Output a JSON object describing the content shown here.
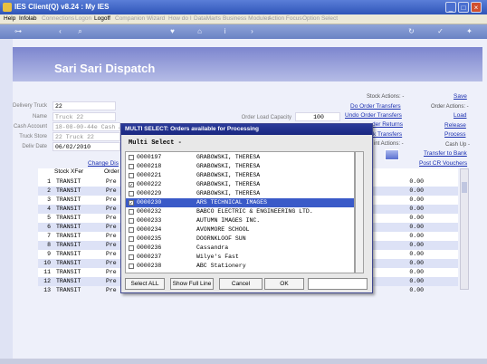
{
  "window": {
    "title": "IES Client(Q) v8.24 : My IES",
    "min": "_",
    "max": "□",
    "close": "×"
  },
  "menu": [
    {
      "label": "Help",
      "disabled": false
    },
    {
      "label": "Infolab",
      "disabled": false
    },
    {
      "label": "Connections",
      "disabled": true
    },
    {
      "label": "Logon",
      "disabled": true
    },
    {
      "label": "Logoff",
      "disabled": false
    },
    {
      "label": "Companion",
      "disabled": true
    },
    {
      "label": "Wizard",
      "disabled": true
    },
    {
      "label": "How do I",
      "disabled": true
    },
    {
      "label": "DataMarts",
      "disabled": true
    },
    {
      "label": "Business Modules",
      "disabled": true
    },
    {
      "label": "Action Focus",
      "disabled": true
    },
    {
      "label": "Option Select",
      "disabled": true
    }
  ],
  "toolbar_icons": [
    "key-icon",
    "back-icon",
    "search-icon",
    "heart-icon",
    "home-icon",
    "info-icon",
    "forward-icon",
    "check-icon"
  ],
  "page_title": "Sari Sari Dispatch",
  "form": {
    "delivery_truck_label": "Delivery Truck",
    "delivery_truck": "22",
    "name_label": "Name",
    "name": "Truck 22",
    "cash_account_label": "Cash Account",
    "cash_account": "18-08-00-44e Cash A",
    "truck_store_label": "Truck Store",
    "truck_store": "22 Truck 22",
    "delivery_date_label": "Deliv Date",
    "delivery_date": "06/02/2010",
    "order_load_capacity_label": "Order Load Capacity",
    "order_load_capacity": "100",
    "change_link": "Change Dis"
  },
  "actions": {
    "stock_actions": "Stock Actions: -",
    "do_order_transfers": "Do Order Transfers",
    "undo_order_transfers": "Undo Order Transfers",
    "order_returns": "der Returns",
    "transfers": "k Transfers",
    "print_actions": "int Actions: -",
    "save": "Save",
    "order_actions": "Order Actions: -",
    "load": "Load",
    "release": "Release",
    "process": "Process",
    "cash_up": "Cash Up -",
    "transfer_to_bank": "Transfer to Bank",
    "post_cr_vouchers": "Post CR Vouchers"
  },
  "grid": {
    "col_stock_xfer": "Stock XFer",
    "col_order": "Order",
    "rows": [
      {
        "n": "1",
        "xfer": "TRANSIT",
        "order": "Pre",
        "amount": "0.00"
      },
      {
        "n": "2",
        "xfer": "TRANSIT",
        "order": "Pre",
        "amount": "0.00"
      },
      {
        "n": "3",
        "xfer": "TRANSIT",
        "order": "Pre",
        "amount": "0.00"
      },
      {
        "n": "4",
        "xfer": "TRANSIT",
        "order": "Pre",
        "amount": "0.00"
      },
      {
        "n": "5",
        "xfer": "TRANSIT",
        "order": "Pre",
        "amount": "0.00"
      },
      {
        "n": "6",
        "xfer": "TRANSIT",
        "order": "Pre",
        "amount": "0.00"
      },
      {
        "n": "7",
        "xfer": "TRANSIT",
        "order": "Pre",
        "amount": "0.00"
      },
      {
        "n": "8",
        "xfer": "TRANSIT",
        "order": "Pre",
        "amount": "0.00"
      },
      {
        "n": "9",
        "xfer": "TRANSIT",
        "order": "Pre",
        "amount": "0.00"
      },
      {
        "n": "10",
        "xfer": "TRANSIT",
        "order": "Pre",
        "amount": "0.00"
      },
      {
        "n": "11",
        "xfer": "TRANSIT",
        "order": "Pre",
        "amount": "0.00"
      },
      {
        "n": "12",
        "xfer": "TRANSIT",
        "order": "Pre",
        "amount": "0.00"
      },
      {
        "n": "13",
        "xfer": "TRANSIT",
        "order": "Pre",
        "amount": "0.00"
      }
    ]
  },
  "modal": {
    "title": "MULTI SELECT: Orders available for Processing",
    "subtitle": "Multi Select -",
    "items": [
      {
        "code": "0000197",
        "name": "GRABOWSKI, THERESA",
        "checked": false,
        "selected": false
      },
      {
        "code": "0000218",
        "name": "GRABOWSKI, THERESA",
        "checked": false,
        "selected": false
      },
      {
        "code": "0000221",
        "name": "GRABOWSKI, THERESA",
        "checked": false,
        "selected": false
      },
      {
        "code": "0000222",
        "name": "GRABOWSKI, THERESA",
        "checked": true,
        "selected": false
      },
      {
        "code": "0000229",
        "name": "GRABOWSKI, THERESA",
        "checked": false,
        "selected": false
      },
      {
        "code": "0000230",
        "name": "ARS TECHNICAL IMAGES",
        "checked": true,
        "selected": true
      },
      {
        "code": "0000232",
        "name": "BABCO ELECTRIC & ENGINEERING LTD.",
        "checked": false,
        "selected": false
      },
      {
        "code": "0000233",
        "name": "AUTUMN IMAGES INC.",
        "checked": false,
        "selected": false
      },
      {
        "code": "0000234",
        "name": "AVONMORE SCHOOL",
        "checked": false,
        "selected": false
      },
      {
        "code": "0000235",
        "name": "DOORNKLOOF SUN",
        "checked": false,
        "selected": false
      },
      {
        "code": "0000236",
        "name": "Cassandra",
        "checked": false,
        "selected": false
      },
      {
        "code": "0000237",
        "name": "Wilye's Fast",
        "checked": false,
        "selected": false
      },
      {
        "code": "0000238",
        "name": "ABC Stationery",
        "checked": false,
        "selected": false
      }
    ],
    "select_all": "Select ALL",
    "show_full_line": "Show Full Line",
    "cancel": "Cancel",
    "ok": "OK"
  }
}
